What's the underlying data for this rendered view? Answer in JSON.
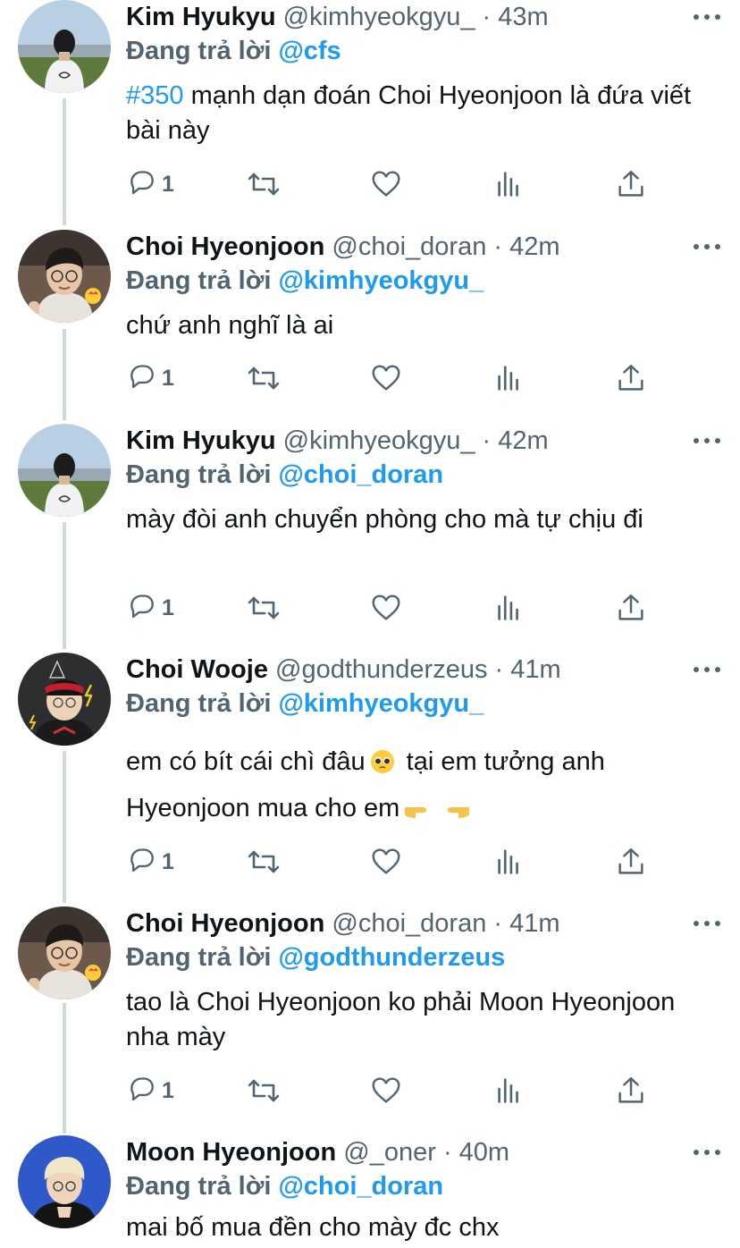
{
  "colors": {
    "accent": "#1d9bf0",
    "secondary": "#536471",
    "text": "#0f1419",
    "thread_line": "#cfd9de"
  },
  "reply_prefix": "Đang trả lời",
  "tweets": [
    {
      "name": "Kim Hyukyu",
      "handle": "@kimhyeokgyu_",
      "time": "· 43m",
      "reply_to": "@cfs",
      "hashtag": "#350",
      "text": " mạnh dạn đoán Choi Hyeonjoon là đứa viết bài này",
      "reply_count": "1"
    },
    {
      "name": "Choi Hyeonjoon",
      "handle": "@choi_doran",
      "time": "· 42m",
      "reply_to": "@kimhyeokgyu_",
      "text": "chứ anh nghĩ là ai",
      "reply_count": "1"
    },
    {
      "name": "Kim Hyukyu",
      "handle": "@kimhyeokgyu_",
      "time": "· 42m",
      "reply_to": "@choi_doran",
      "text": "mày đòi anh chuyển phòng cho mà tự chịu đi",
      "reply_count": "1"
    },
    {
      "name": "Choi Wooje",
      "handle": "@godthunderzeus",
      "time": "· 41m",
      "reply_to": "@kimhyeokgyu_",
      "text_part1": "em có bít cái chì đâu",
      "text_part2": " tại em tưởng anh Hyeonjoon mua cho em",
      "reply_count": "1"
    },
    {
      "name": "Choi Hyeonjoon",
      "handle": "@choi_doran",
      "time": "· 41m",
      "reply_to": "@godthunderzeus",
      "text": "tao là Choi Hyeonjoon ko phải Moon Hyeonjoon nha mày",
      "reply_count": "1"
    },
    {
      "name": "Moon Hyeonjoon",
      "handle": "@_oner",
      "time": "· 40m",
      "reply_to": "@choi_doran",
      "text": "mai bố mua đền cho mày đc chx"
    }
  ]
}
